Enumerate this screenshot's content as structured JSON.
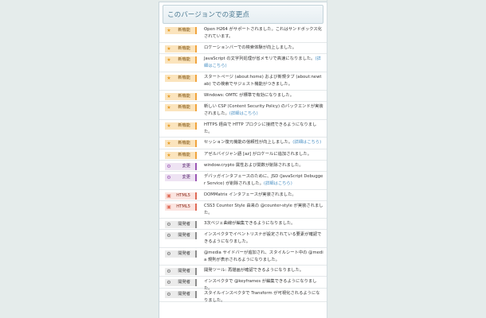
{
  "section": {
    "title": "このバージョンでの変更点"
  },
  "colors": {
    "new": "#f1a43d",
    "change": "#9b58b5",
    "html5": "#df6a55",
    "devtools": "#8c8c8c",
    "link": "#4a90c4"
  },
  "changes": [
    {
      "type": "new",
      "icon": "star-icon",
      "badge": "新機能",
      "text": "Open H264 がサポートされました。これはサンドボックス化されています。"
    },
    {
      "type": "new",
      "icon": "star-icon",
      "badge": "新機能",
      "text": "ロケーションバーでの検索体験が向上しました。"
    },
    {
      "type": "new",
      "icon": "star-icon",
      "badge": "新機能",
      "text": "JavaScript の文字列処理が省メモリで高速になりました。",
      "link": "(詳細はこちら)"
    },
    {
      "type": "new",
      "icon": "star-icon",
      "badge": "新機能",
      "text": "スタートページ (about:home) および新規タブ (about:newtab) での検索でサジェスト機能がつきました。"
    },
    {
      "type": "new",
      "icon": "star-icon",
      "badge": "新機能",
      "text": "Windows: OMTC が標準で有効になりました。"
    },
    {
      "type": "new",
      "icon": "star-icon",
      "badge": "新機能",
      "text": "新しい CSP (Content Security Policy) のバックエンドが実装されました。",
      "link": "(詳細はこちら)"
    },
    {
      "type": "new",
      "icon": "star-icon",
      "badge": "新機能",
      "text": "HTTPS 経由で HTTP プロクシに接続できるようになりました。"
    },
    {
      "type": "new",
      "icon": "star-icon",
      "badge": "新機能",
      "text": "セッション復元機能の信頼性が向上しました。",
      "link": "(詳細はこちら)"
    },
    {
      "type": "new",
      "icon": "star-icon",
      "badge": "新機能",
      "text": "アゼルバイジャン語 [az] がロケールに追加されました。"
    },
    {
      "type": "change",
      "icon": "gear-icon",
      "badge": "変更",
      "text": "window.crypto 属性および関数が削除されました。"
    },
    {
      "type": "change",
      "icon": "gear-icon",
      "badge": "変更",
      "text": "デバッガインタフェースのために、JSD (JavaScript Debugger Service) が削除されました。",
      "link": "(詳細はこちら)"
    },
    {
      "type": "html5",
      "icon": "html5-icon",
      "badge": "HTML5",
      "text": "DOMMatrix インタフェースが実装されました。"
    },
    {
      "type": "html5",
      "icon": "html5-icon",
      "badge": "HTML5",
      "text": "CSS3 Counter Style 由来の @counter-style が実装されました。"
    },
    {
      "type": "dev",
      "icon": "wrench-icon",
      "badge": "開発者",
      "text": "3次ベジェ曲線が編集できるようになりました。"
    },
    {
      "type": "dev",
      "icon": "wrench-icon",
      "badge": "開発者",
      "text": "インスペクタでイベントリスナが設定されている要素が確認できるようになりました。"
    },
    {
      "type": "dev",
      "icon": "wrench-icon",
      "badge": "開発者",
      "text": "@media サイドバーが追加され、スタイルシート中の @media 規則が表示されるようになりました。"
    },
    {
      "type": "dev",
      "icon": "wrench-icon",
      "badge": "開発者",
      "text": "開発ツール: 再描画が確認できるようになりました。"
    },
    {
      "type": "dev",
      "icon": "wrench-icon",
      "badge": "開発者",
      "text": "インスペクタで @keyframes が編集できるようになりました。"
    },
    {
      "type": "dev",
      "icon": "wrench-icon",
      "badge": "開発者",
      "text": "スタイルインスペクタで Transform が可視化されるようになりました。"
    }
  ]
}
